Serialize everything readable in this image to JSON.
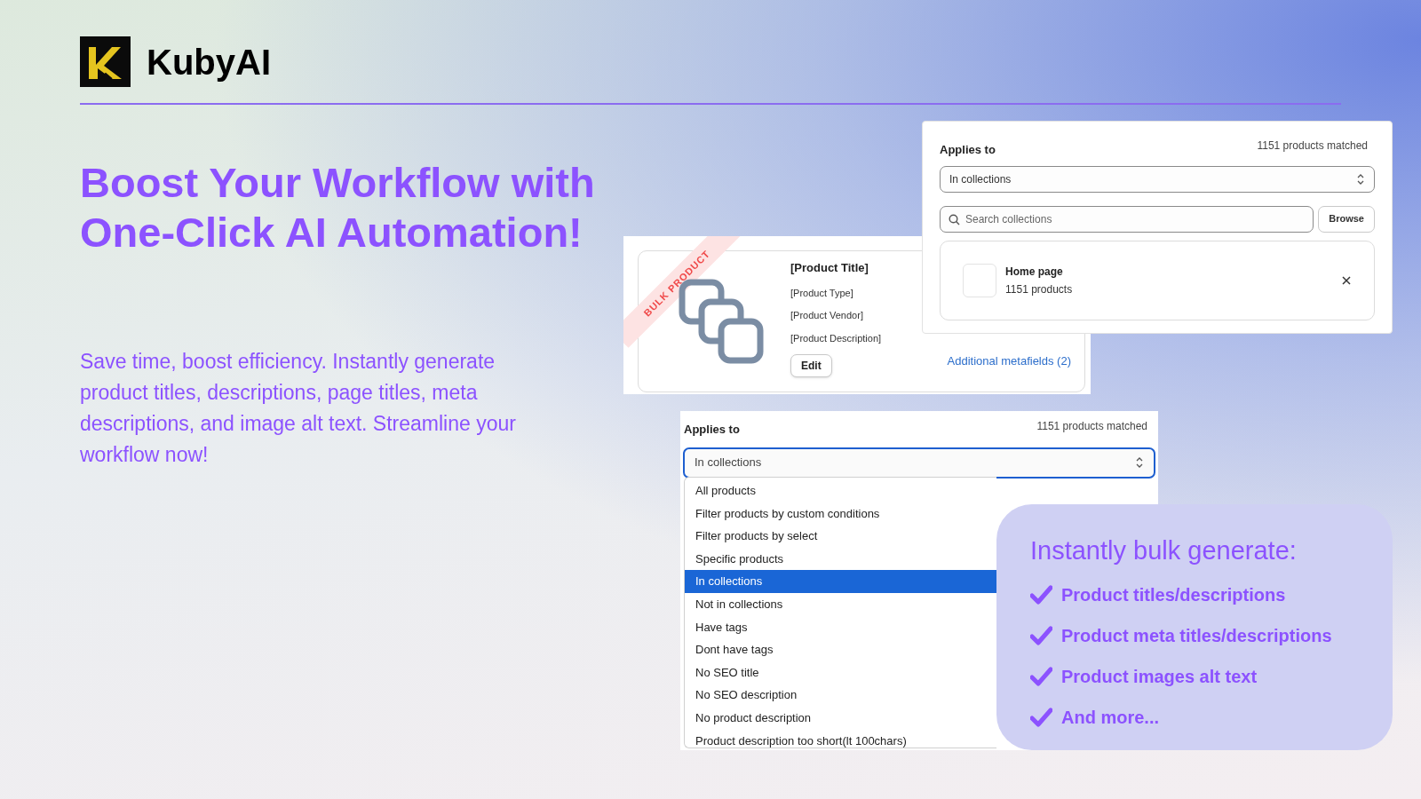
{
  "brand": {
    "name": "KubyAI"
  },
  "headline": [
    "Boost Your Workflow with",
    "One-Click AI Automation!"
  ],
  "description": "Save time, boost efficiency. Instantly generate product titles, descriptions, page titles, meta descriptions, and image alt text. Streamline your workflow now!",
  "product_card": {
    "ribbon": "BULK PRODUCT",
    "title": "[Product Title]",
    "fields": [
      "[Product Type]",
      "[Product Vendor]",
      "[Product Description]"
    ],
    "edit_button": "Edit",
    "link": "Additional metafields (2)"
  },
  "collections_panel": {
    "label": "Applies to",
    "matched": "1151 products matched",
    "select": "In collections",
    "search": {
      "placeholder": "Search collections"
    },
    "browse_button": "Browse",
    "collections": [
      {
        "name": "Home page",
        "count": "1151 products"
      }
    ]
  },
  "dropdown_panel": {
    "label": "Applies to",
    "matched": "1151 products matched",
    "select": "In collections",
    "options": [
      {
        "label": "All products",
        "selected": false
      },
      {
        "label": "Filter products by custom conditions",
        "selected": false
      },
      {
        "label": "Filter products by select",
        "selected": false
      },
      {
        "label": "Specific products",
        "selected": false
      },
      {
        "label": "In collections",
        "selected": true
      },
      {
        "label": "Not in collections",
        "selected": false
      },
      {
        "label": "Have tags",
        "selected": false
      },
      {
        "label": "Dont have tags",
        "selected": false
      },
      {
        "label": "No SEO title",
        "selected": false
      },
      {
        "label": "No SEO description",
        "selected": false
      },
      {
        "label": "No product description",
        "selected": false
      },
      {
        "label": "Product description too short(lt 100chars)",
        "selected": false
      }
    ]
  },
  "bulk_box": {
    "title": "Instantly bulk generate:",
    "items": [
      "Product titles/descriptions",
      "Product meta titles/descriptions",
      "Product images alt text",
      "And more..."
    ]
  }
}
